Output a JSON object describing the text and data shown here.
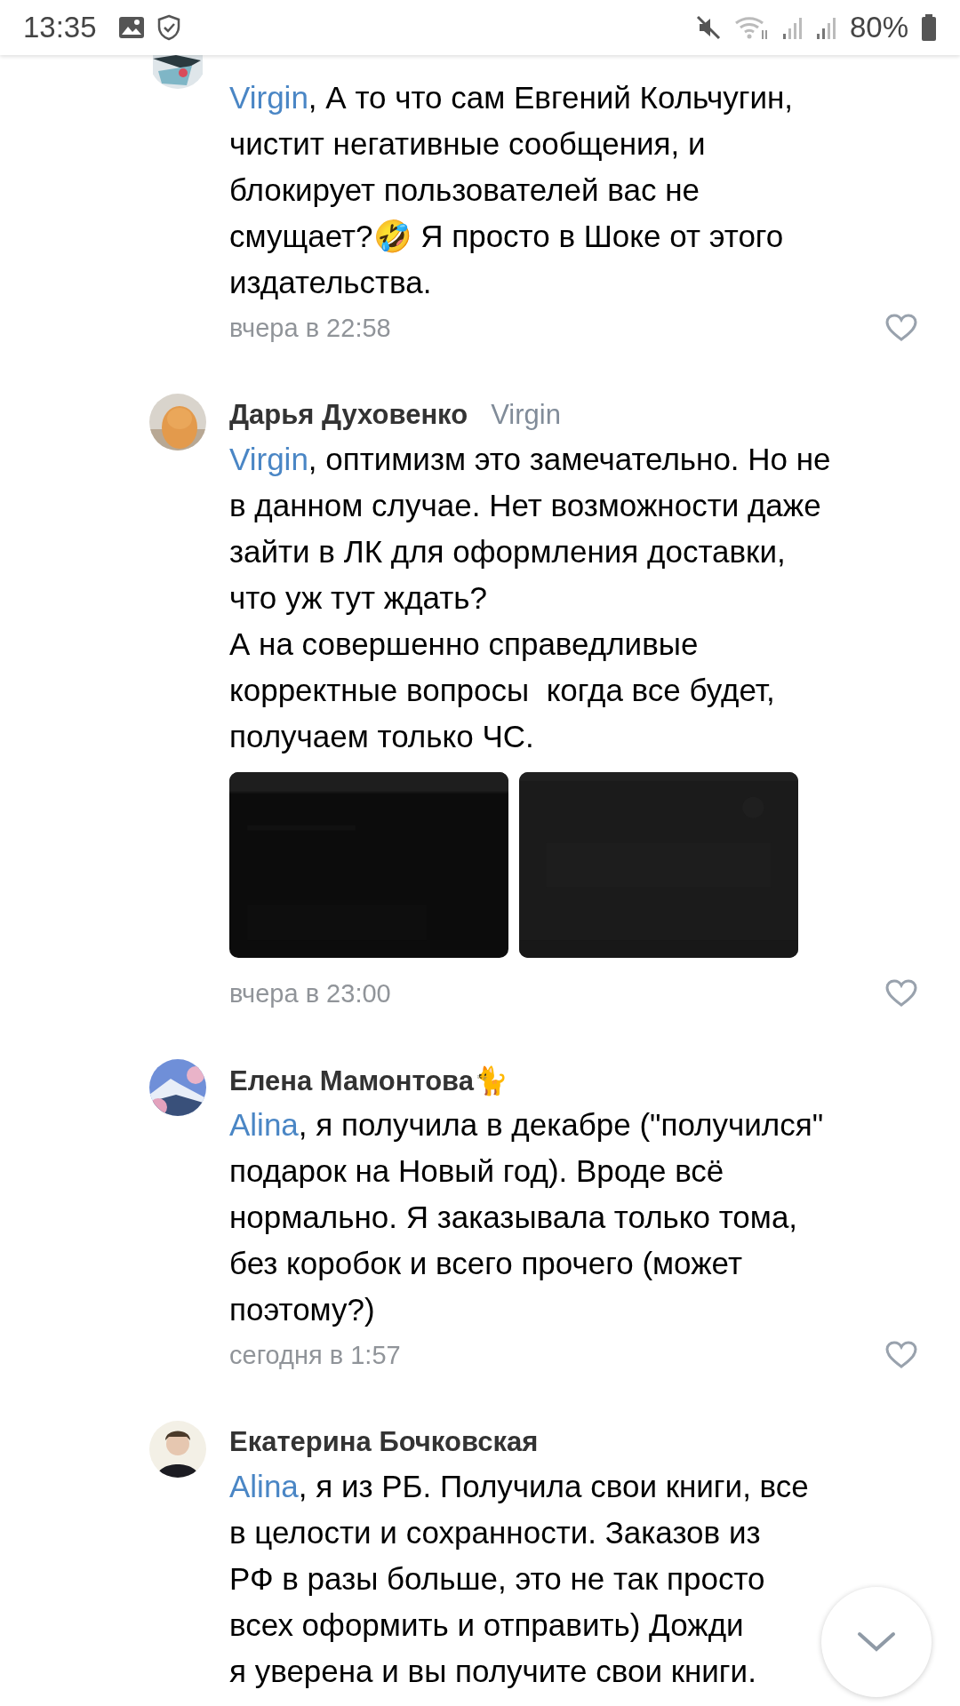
{
  "status_bar": {
    "time": "13:35",
    "battery": "80%"
  },
  "comments": [
    {
      "kind": "cut",
      "mention": "Virgin",
      "text": ", А то что сам Евгений Кольчугин,\nчистит негативные сообщения, и\nблокирует пользователей вас не\nсмущает?🤣 Я просто в Шоке от этого\nиздательства.",
      "time": "вчера в 22:58"
    },
    {
      "kind": "full",
      "name": "Дарья Духовенко",
      "reply_to": "Virgin",
      "mention": "Virgin",
      "text": ", оптимизм это замечательно. Но не\nв данном случае. Нет возможности даже\nзайти в ЛК для оформления доставки,\nчто уж тут ждать?\nА на совершенно справедливые\nкорректные вопросы  когда все будет,\nполучаем только ЧС.",
      "time": "вчера в 23:00"
    },
    {
      "kind": "full",
      "name": "Елена Мамонтова🐈",
      "mention": "Alina",
      "text": ", я получила в декабре (\"получился\"\nподарок на Новый год). Вроде всё\nнормально. Я заказывала только тома,\nбез коробок и всего прочего (может\nпоэтому?)",
      "time": "сегодня в 1:57"
    },
    {
      "kind": "full",
      "name": "Екатерина Бочковская",
      "mention": "Alina",
      "text": ", я из РБ. Получила свои книги, все\nв целости и сохранности. Заказов из\nРФ в разы больше, это не так просто\nвсех оформить и отправить) Дожди\nя уверена и вы получите свои книги."
    }
  ]
}
